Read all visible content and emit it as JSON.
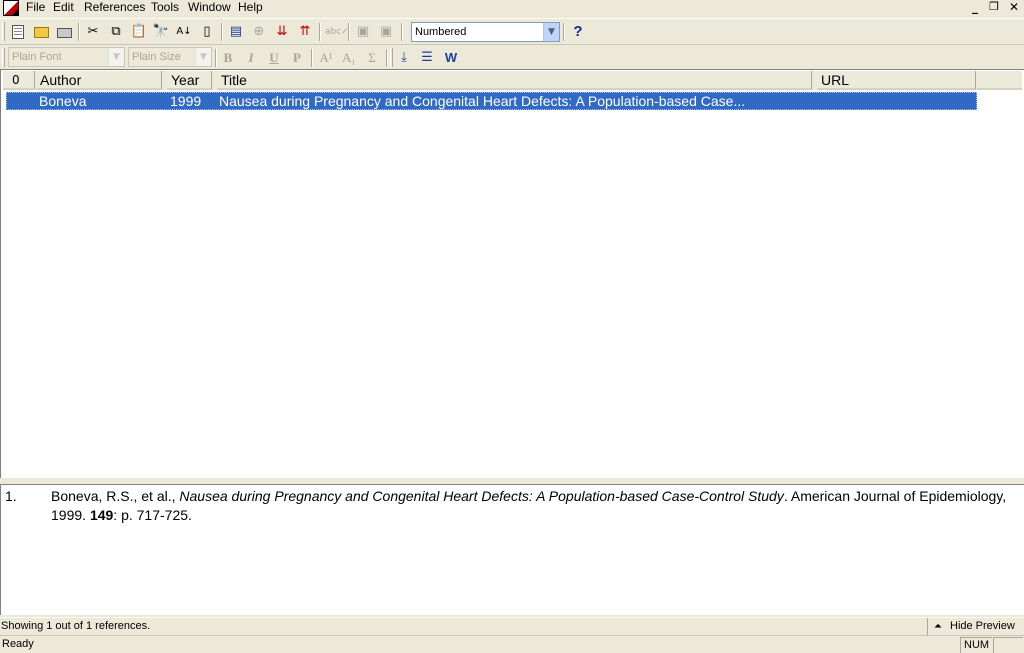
{
  "menu": [
    "File",
    "Edit",
    "References",
    "Tools",
    "Window",
    "Help"
  ],
  "toolbar": {
    "style_value": "Numbered",
    "font_value": "Plain Font",
    "size_value": "Plain Size",
    "help_glyph": "?",
    "bold_glyph": "B",
    "italic_glyph": "I",
    "underline_glyph": "U",
    "plain_glyph": "P",
    "superscript_glyph": "A¹",
    "subscript_glyph": "A₁",
    "symbol_glyph": "Σ"
  },
  "columns": {
    "attachment": "0",
    "author": "Author",
    "year": "Year",
    "title": "Title",
    "url": "URL"
  },
  "rows": [
    {
      "author": "Boneva",
      "year": "1999",
      "title": "Nausea during Pregnancy and Congenital Heart Defects: A Population-based Case...",
      "url": ""
    }
  ],
  "preview": {
    "number": "1.",
    "authors": "Boneva, R.S., et al., ",
    "title": "Nausea during Pregnancy and Congenital Heart Defects: A Population-based Case-Control Study",
    "journal": ". American Journal of Epidemiology, 1999. ",
    "volume": "149",
    "pages": ": p. 717-725."
  },
  "status": {
    "count_text": "Showing 1 out of 1 references.",
    "hide_preview": "Hide Preview",
    "ready": "Ready",
    "num": "NUM"
  },
  "window_controls": [
    "_",
    "❐",
    "✕"
  ]
}
